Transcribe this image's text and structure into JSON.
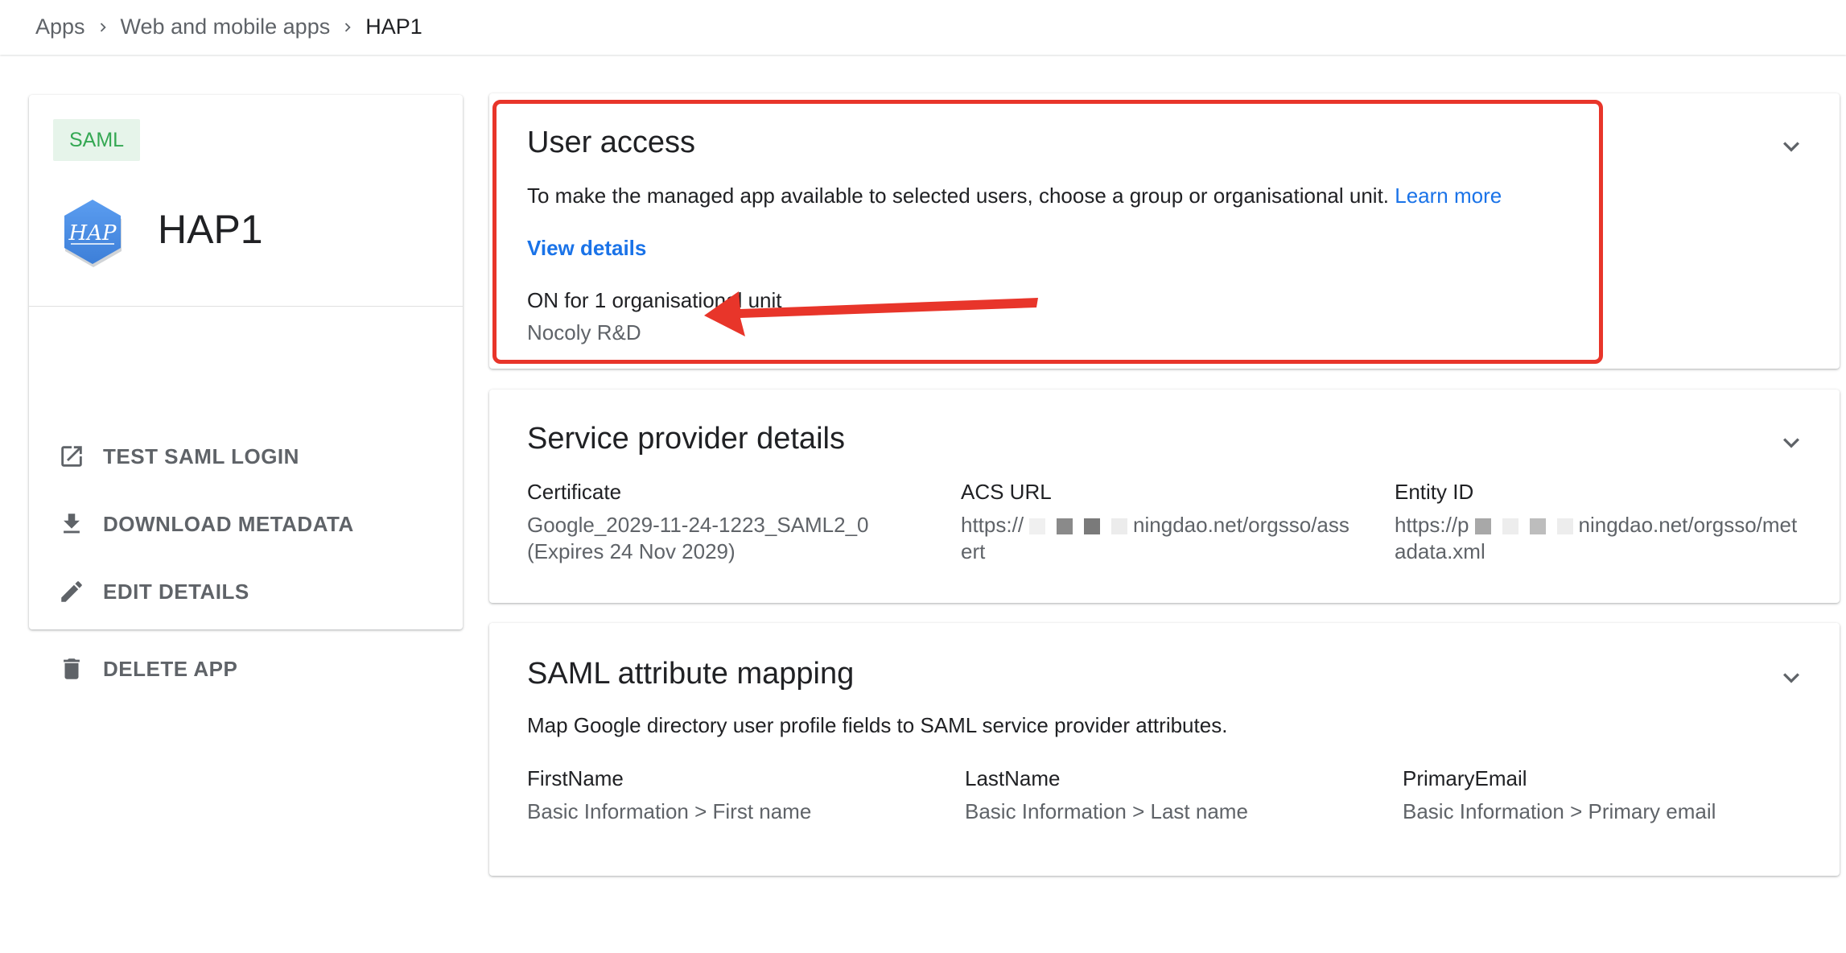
{
  "breadcrumb": {
    "items": [
      "Apps",
      "Web and mobile apps",
      "HAP1"
    ]
  },
  "app": {
    "type_chip": "SAML",
    "name": "HAP1",
    "logo_text": "HAP"
  },
  "actions": {
    "test_login": "TEST SAML LOGIN",
    "download_metadata": "DOWNLOAD METADATA",
    "edit_details": "EDIT DETAILS",
    "delete_app": "DELETE APP"
  },
  "user_access": {
    "title": "User access",
    "description": "To make the managed app available to selected users, choose a group or organisational unit.",
    "learn_more": "Learn more",
    "view_details": "View details",
    "status": "ON for 1 organisational unit",
    "org_unit": "Nocoly R&D"
  },
  "service_provider": {
    "title": "Service provider details",
    "certificate_label": "Certificate",
    "certificate_value": "Google_2029-11-24-1223_SAML2_0",
    "certificate_expiry": "(Expires 24 Nov 2029)",
    "acs_label": "ACS URL",
    "acs_prefix": "https://",
    "acs_suffix": "ningdao.net/orgsso/ass",
    "acs_suffix2": "ert",
    "entity_label": "Entity ID",
    "entity_prefix": "https://p",
    "entity_suffix": "ningdao.net/orgsso/met",
    "entity_suffix2": "adata.xml"
  },
  "attribute_mapping": {
    "title": "SAML attribute mapping",
    "description": "Map Google directory user profile fields to SAML service provider attributes.",
    "fields": [
      {
        "label": "FirstName",
        "value": "Basic Information > First name"
      },
      {
        "label": "LastName",
        "value": "Basic Information > Last name"
      },
      {
        "label": "PrimaryEmail",
        "value": "Basic Information > Primary email"
      }
    ]
  },
  "colors": {
    "accent_blue": "#1a73e8",
    "chip_green": "#34a853",
    "annotation_red": "#e8352a"
  }
}
